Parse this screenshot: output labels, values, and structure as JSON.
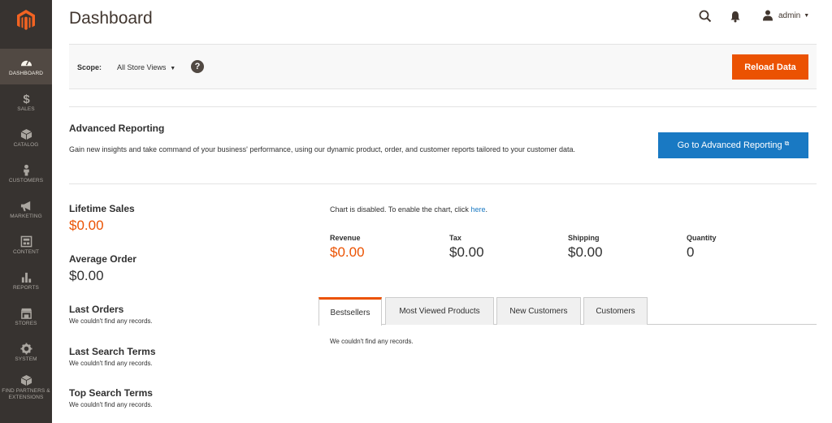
{
  "colors": {
    "sidebar": "#373330",
    "sidebar_active": "#514943",
    "accent": "#eb5202",
    "link": "#1979c3"
  },
  "sidebar": {
    "logo_icon": "magento-logo-icon",
    "items": [
      {
        "label": "DASHBOARD",
        "icon": "speedometer-icon",
        "active": true
      },
      {
        "label": "SALES",
        "icon": "dollar-icon"
      },
      {
        "label": "CATALOG",
        "icon": "cube-icon"
      },
      {
        "label": "CUSTOMERS",
        "icon": "person-icon"
      },
      {
        "label": "MARKETING",
        "icon": "megaphone-icon"
      },
      {
        "label": "CONTENT",
        "icon": "layout-icon"
      },
      {
        "label": "REPORTS",
        "icon": "bar-chart-icon"
      },
      {
        "label": "STORES",
        "icon": "storefront-icon"
      },
      {
        "label": "SYSTEM",
        "icon": "gear-icon"
      },
      {
        "label": "FIND PARTNERS & EXTENSIONS",
        "icon": "box-icon"
      }
    ]
  },
  "header": {
    "title": "Dashboard",
    "user": "admin"
  },
  "scope": {
    "label": "Scope:",
    "value": "All Store Views",
    "help": "?",
    "reload_label": "Reload Data"
  },
  "advanced_reporting": {
    "title": "Advanced Reporting",
    "text": "Gain new insights and take command of your business' performance, using our dynamic product, order, and customer reports tailored to your customer data.",
    "button_label": "Go to Advanced Reporting"
  },
  "stats": {
    "lifetime_sales": {
      "title": "Lifetime Sales",
      "value": "$0.00"
    },
    "average_order": {
      "title": "Average Order",
      "value": "$0.00"
    },
    "last_orders": {
      "title": "Last Orders",
      "empty": "We couldn't find any records."
    },
    "last_search_terms": {
      "title": "Last Search Terms",
      "empty": "We couldn't find any records."
    },
    "top_search_terms": {
      "title": "Top Search Terms",
      "empty": "We couldn't find any records."
    }
  },
  "chart": {
    "disabled_text": "Chart is disabled. To enable the chart, click ",
    "link_text": "here",
    "disabled_suffix": "."
  },
  "metrics": [
    {
      "label": "Revenue",
      "value": "$0.00"
    },
    {
      "label": "Tax",
      "value": "$0.00"
    },
    {
      "label": "Shipping",
      "value": "$0.00"
    },
    {
      "label": "Quantity",
      "value": "0"
    }
  ],
  "tabs": [
    {
      "label": "Bestsellers",
      "active": true
    },
    {
      "label": "Most Viewed Products"
    },
    {
      "label": "New Customers"
    },
    {
      "label": "Customers"
    }
  ],
  "tab_content": {
    "empty": "We couldn't find any records."
  }
}
